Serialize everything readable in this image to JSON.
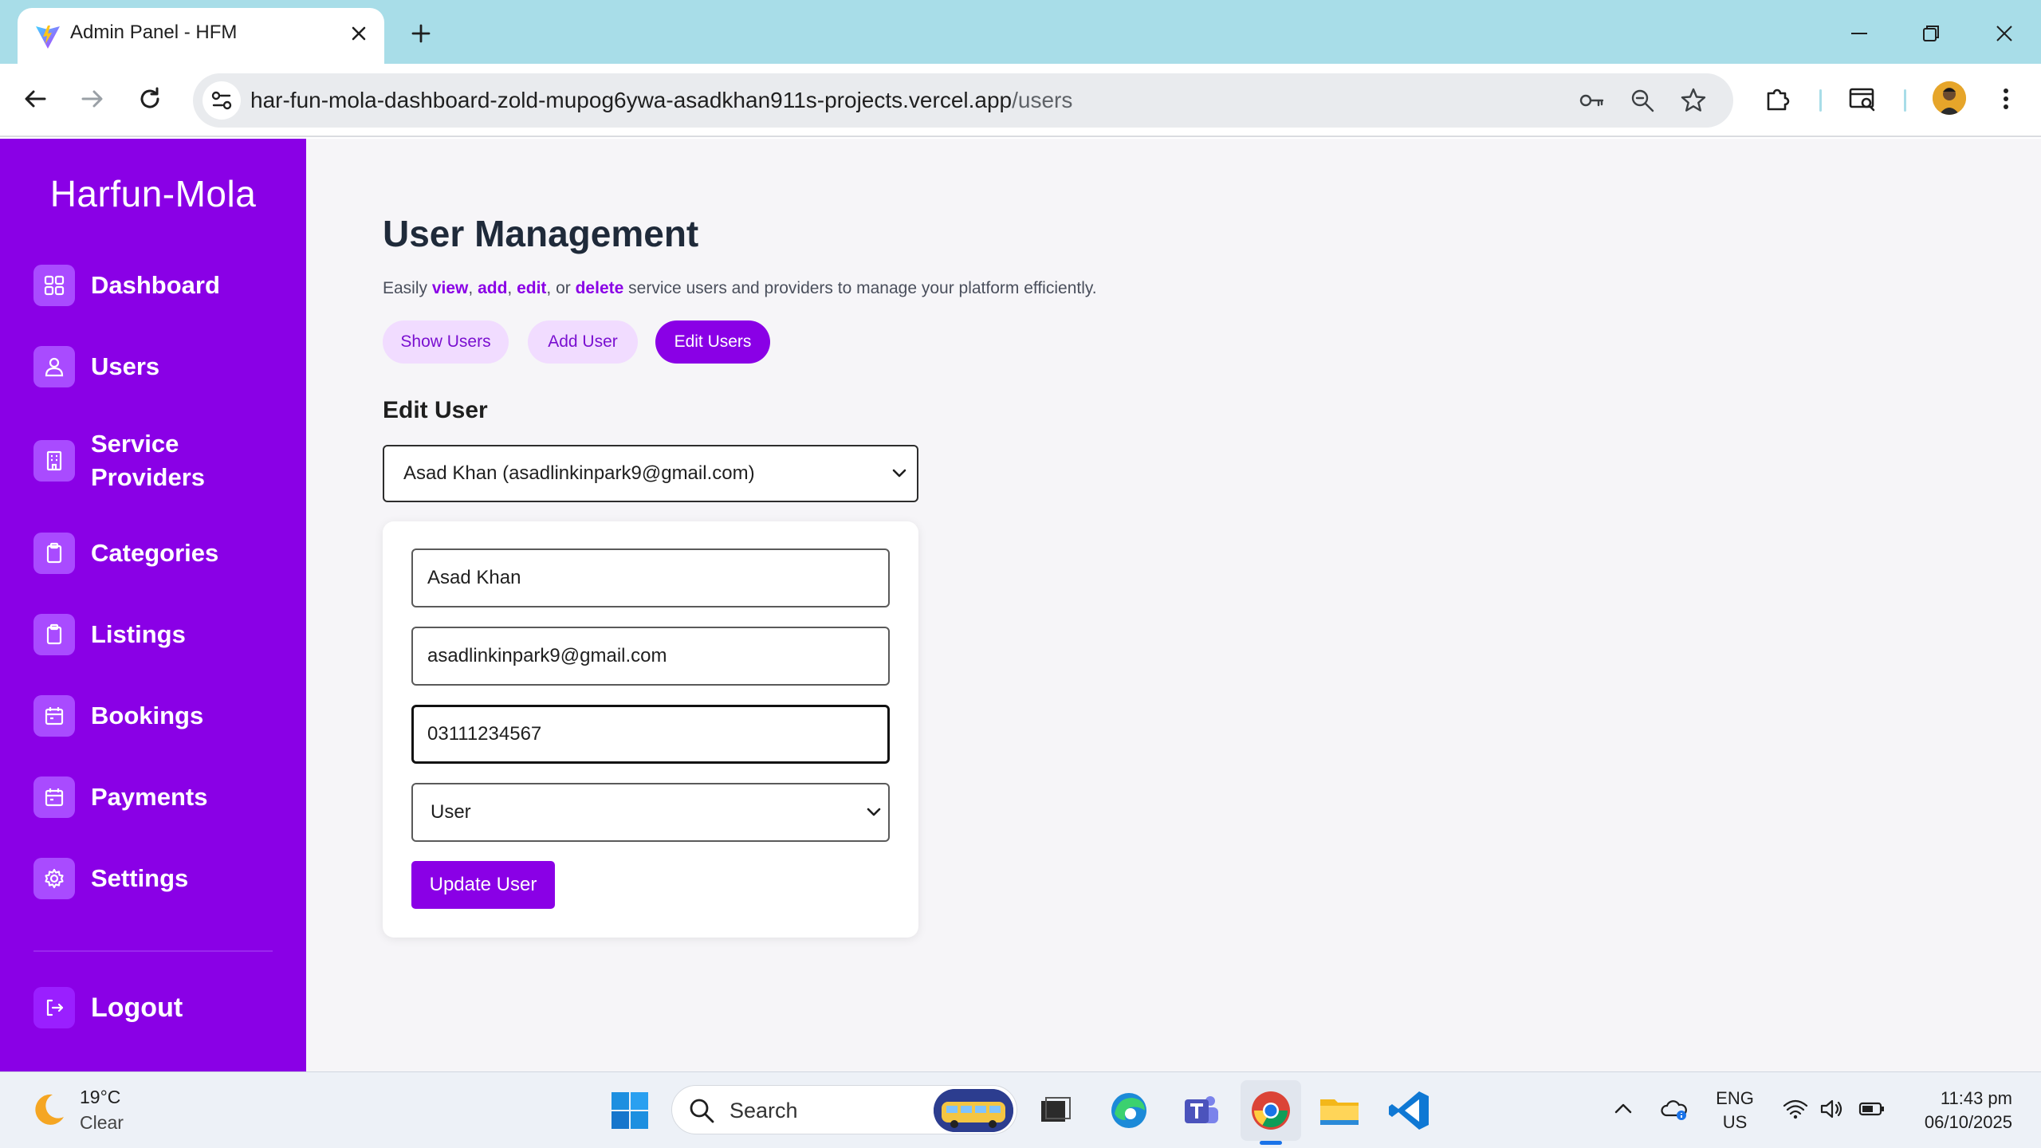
{
  "browser": {
    "tab_title": "Admin Panel - HFM",
    "url_host": "har-fun-mola-dashboard-zold-mupog6ywa-asadkhan911s-projects.vercel.app",
    "url_path": "/users"
  },
  "sidebar": {
    "brand": "Harfun-Mola",
    "items": [
      {
        "label": "Dashboard",
        "icon": "grid-icon"
      },
      {
        "label": "Users",
        "icon": "users-icon"
      },
      {
        "label": "Service Providers",
        "icon": "building-icon"
      },
      {
        "label": "Categories",
        "icon": "clipboard-icon"
      },
      {
        "label": "Listings",
        "icon": "clipboard-icon"
      },
      {
        "label": "Bookings",
        "icon": "calendar-icon"
      },
      {
        "label": "Payments",
        "icon": "calendar-icon"
      },
      {
        "label": "Settings",
        "icon": "gear-icon"
      }
    ],
    "logout": "Logout"
  },
  "main": {
    "title": "User Management",
    "subtitle": {
      "p1": "Easily ",
      "view": "view",
      "sep1": ", ",
      "add": "add",
      "sep2": ", ",
      "edit": "edit",
      "sep3": ", or ",
      "delete": "delete",
      "p2": " service users and providers to manage your platform efficiently."
    },
    "tabs": [
      "Show Users",
      "Add User",
      "Edit Users"
    ],
    "active_tab": "Edit Users",
    "section_title": "Edit User",
    "selected_user": "Asad Khan (asadlinkinpark9@gmail.com)",
    "form": {
      "name": "Asad Khan",
      "email": "asadlinkinpark9@gmail.com",
      "phone": "03111234567",
      "role": "User",
      "submit": "Update User"
    }
  },
  "taskbar": {
    "temperature": "19°C",
    "condition": "Clear",
    "search_label": "Search",
    "lang_top": "ENG",
    "lang_bottom": "US",
    "time": "11:43 pm",
    "date": "06/10/2025"
  },
  "colors": {
    "accent": "#8a00e6",
    "accent_light": "#f1dcff",
    "tabbar": "#a8dde8"
  }
}
